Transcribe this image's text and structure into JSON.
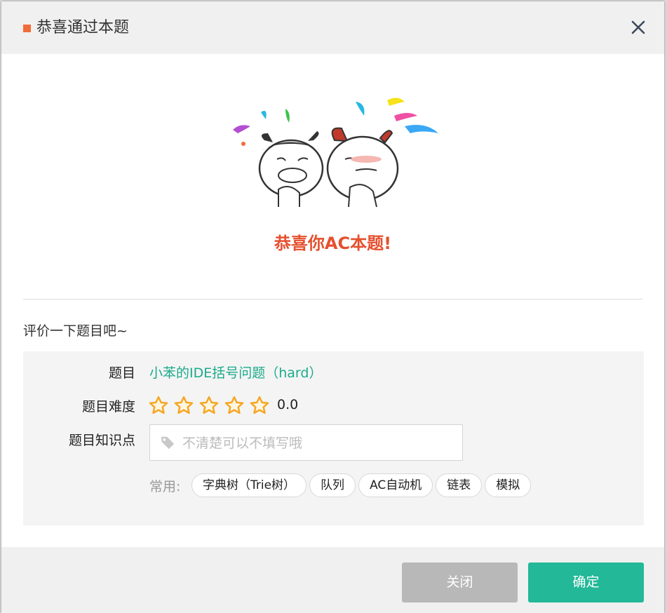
{
  "dialog": {
    "title": "恭喜通过本题",
    "congrats_text": "恭喜你AC本题!",
    "rate_prompt": "评价一下题目吧~",
    "accent_color": "#f26b3a"
  },
  "form": {
    "problem_label": "题目",
    "problem_name": "小苯的IDE括号问题（hard）",
    "difficulty_label": "题目难度",
    "difficulty_stars_total": 5,
    "difficulty_value": "0.0",
    "knowledge_label": "题目知识点",
    "tag_input_placeholder": "不清楚可以不填写哦",
    "tag_input_value": "",
    "common_label": "常用:",
    "common_tags": [
      "字典树（Trie树）",
      "队列",
      "AC自动机",
      "链表",
      "模拟"
    ]
  },
  "buttons": {
    "close_label": "关闭",
    "ok_label": "确定",
    "ok_color": "#23b897",
    "close_color": "#b8b8b8"
  },
  "icons": {
    "close": "close-icon",
    "tag": "tag-icon",
    "star": "star-outline-icon"
  }
}
